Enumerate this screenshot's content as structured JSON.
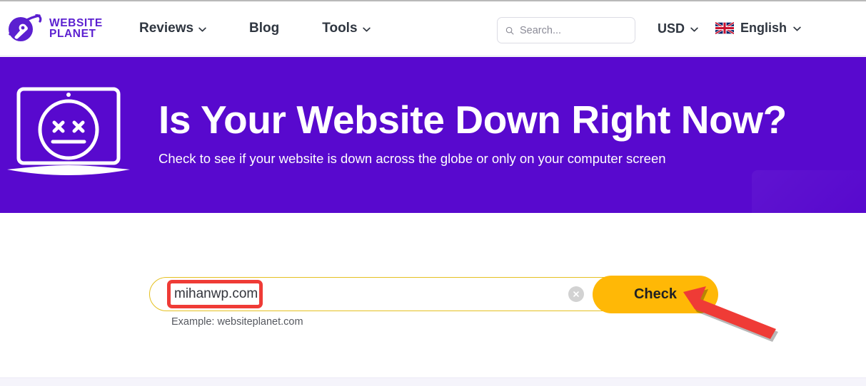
{
  "header": {
    "logo": {
      "icon": "planet-comet-logo",
      "line1": "WEBSITE",
      "line2": "PLANET",
      "color": "#5b1fd0"
    },
    "nav": [
      {
        "label": "Reviews",
        "has_chevron": true
      },
      {
        "label": "Blog",
        "has_chevron": false
      },
      {
        "label": "Tools",
        "has_chevron": true
      }
    ],
    "search": {
      "icon": "search-icon",
      "placeholder": "Search...",
      "value": ""
    },
    "currency": {
      "label": "USD",
      "has_chevron": true
    },
    "language": {
      "label": "English",
      "flag": "uk-flag-icon",
      "has_chevron": true
    }
  },
  "hero": {
    "icon": "laptop-dead-face-icon",
    "title": "Is Your Website Down Right Now?",
    "subtitle": "Check to see if your website is down across the globe or only on your computer screen",
    "background_color": "#5809ce"
  },
  "form": {
    "domain_value": "mihanwp.com",
    "domain_placeholder": "",
    "clear_icon": "close-circle-icon",
    "check_label": "Check",
    "check_color": "#ffb806",
    "example_text": "Example: websiteplanet.com",
    "border_color": "#e5c020"
  },
  "annotations": {
    "highlight_color": "#ef3b36",
    "box_target": "domain-input",
    "arrow_target": "check-button"
  }
}
